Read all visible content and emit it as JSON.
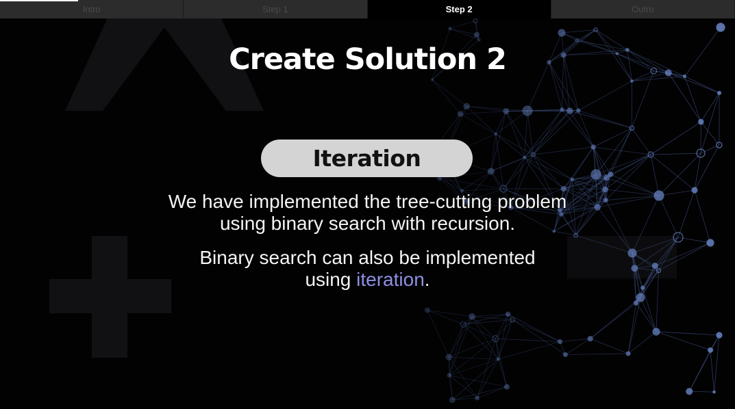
{
  "tabs": [
    {
      "label": "Intro",
      "active": false
    },
    {
      "label": "Step 1",
      "active": false
    },
    {
      "label": "Step 2",
      "active": true
    },
    {
      "label": "Outro",
      "active": false
    }
  ],
  "slide": {
    "title": "Create Solution 2",
    "pill_label": "Iteration",
    "paragraph1": {
      "line1": "We have implemented the tree-cutting problem",
      "line2": "using binary search with recursion."
    },
    "paragraph2": {
      "line1": "Binary search can also be implemented",
      "line2_before": "using ",
      "line2_highlight": "iteration",
      "line2_after": "."
    }
  },
  "colors": {
    "background": "#020203",
    "tab_active_bg": "#000000",
    "tab_inactive_bg": "#2c2c2c",
    "pill_bg": "#d4d4d4",
    "highlight": "#8f8fe3",
    "network_nodes": "#6a86c8"
  }
}
